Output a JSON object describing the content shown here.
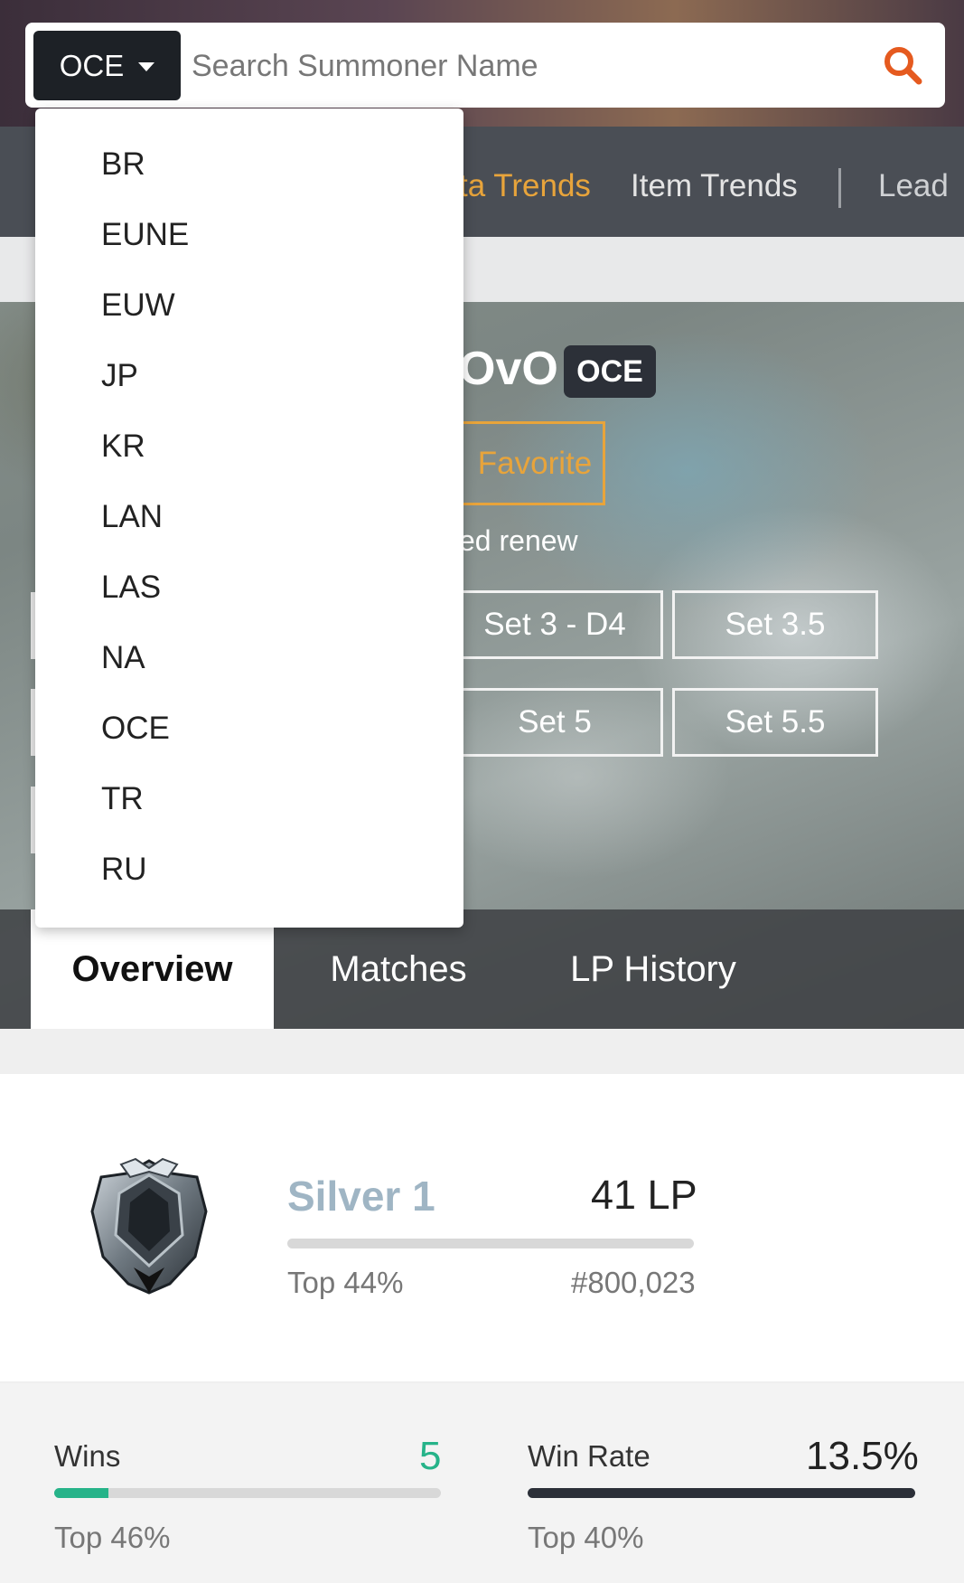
{
  "search": {
    "region": "OCE",
    "placeholder": "Search Summoner Name"
  },
  "nav": {
    "items": [
      {
        "label": "ta Trends",
        "active": true
      },
      {
        "label": "Item Trends",
        "active": false
      },
      {
        "label": "Lead",
        "active": false
      }
    ]
  },
  "region_dropdown": {
    "items": [
      "BR",
      "EUNE",
      "EUW",
      "JP",
      "KR",
      "LAN",
      "LAS",
      "NA",
      "OCE",
      "TR",
      "RU"
    ]
  },
  "profile": {
    "name_fragment": "OvO",
    "region_tag": "OCE",
    "favorite_label": "Favorite",
    "renew_text": "ed renew",
    "sets": [
      "Set 3 - D4",
      "Set 3.5",
      "Set 5",
      "Set 5.5"
    ]
  },
  "tabs": [
    {
      "label": "Overview",
      "active": true
    },
    {
      "label": "Matches",
      "active": false
    },
    {
      "label": "LP History",
      "active": false
    }
  ],
  "rank": {
    "tier": "Silver 1",
    "lp": "41 LP",
    "top_percent": "Top 44%",
    "rank_number": "#800,023",
    "lp_progress": 0
  },
  "stats": {
    "wins": {
      "label": "Wins",
      "value": "5",
      "sub": "Top 46%",
      "progress": 0.14,
      "color": "#26b389"
    },
    "win_rate": {
      "label": "Win Rate",
      "value": "13.5%",
      "sub": "Top 40%",
      "progress": 1.0,
      "color": "#2b2f38"
    }
  },
  "colors": {
    "accent": "#e8a43b",
    "search_icon": "#e55a1f",
    "tier": "#9fb5c4"
  }
}
